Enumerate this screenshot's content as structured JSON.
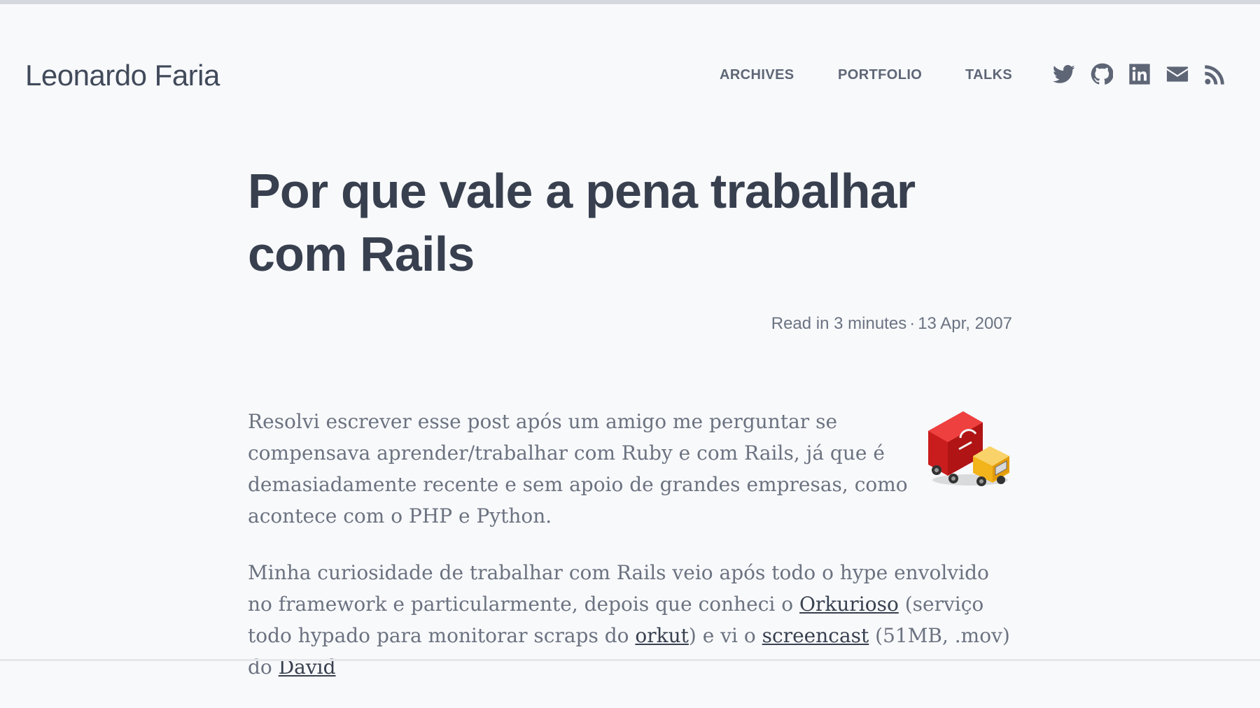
{
  "site": {
    "title": "Leonardo Faria"
  },
  "nav": {
    "items": [
      {
        "label": "ARCHIVES"
      },
      {
        "label": "PORTFOLIO"
      },
      {
        "label": "TALKS"
      }
    ],
    "social": [
      {
        "icon": "twitter-icon"
      },
      {
        "icon": "github-icon"
      },
      {
        "icon": "linkedin-icon"
      },
      {
        "icon": "email-icon"
      },
      {
        "icon": "rss-icon"
      }
    ]
  },
  "post": {
    "title": "Por que vale a pena trabalhar com Rails",
    "read_time": "Read in 3 minutes",
    "separator": "·",
    "date": "13 Apr, 2007",
    "paragraph1": "Resolvi escrever esse post após um amigo me perguntar se compensava aprender/trabalhar com Ruby e com Rails, já que é demasiadamente recente e sem apoio de grandes empresas, como acontece com o PHP e Python.",
    "p2": {
      "t1": "Minha curiosidade de trabalhar com Rails veio após todo o hype envolvido no framework e particularmente, depois que conheci o ",
      "link_orkurioso": "Orkurioso",
      "t2": " (serviço todo hypado para monitorar scraps do ",
      "link_orkut": "orkut",
      "t3": ") e vi o ",
      "link_screencast": "screencast",
      "t4": " (51MB, .mov) do ",
      "link_david": "David"
    }
  },
  "colors": {
    "background": "#f8f9fb",
    "title": "#38404f",
    "nav": "#5e6676",
    "body_text": "#6b7280"
  }
}
